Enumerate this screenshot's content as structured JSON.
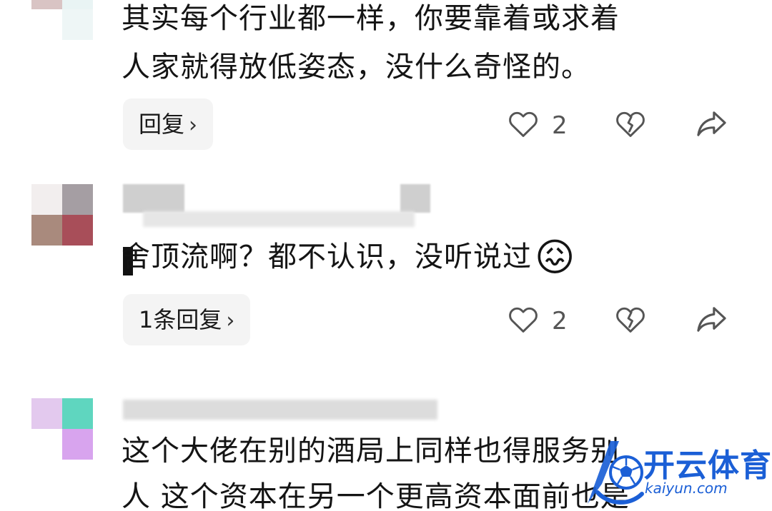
{
  "comments": [
    {
      "lines": [
        "其实每个行业都一样，你要靠着或求着",
        "人家就得放低姿态，没什么奇怪的。"
      ],
      "reply_label": "回复",
      "like_count": "2"
    },
    {
      "lines": [
        "舍顶流啊？都不认识，没听说过"
      ],
      "emoji": "😖",
      "reply_label": "1条回复",
      "like_count": "2"
    },
    {
      "lines": [
        "这个大佬在别的酒局上同样也得服务别",
        "人 这个资本在另一个更高资本面前也是"
      ]
    }
  ],
  "icons": {
    "like": "heart-outline-icon",
    "dislike": "broken-heart-icon",
    "share": "share-arrow-icon",
    "chevron": "chevron-right-icon"
  },
  "watermark": {
    "title": "开云体育",
    "url": "kaiyun.com"
  },
  "colors": {
    "text": "#141414",
    "count": "#555555",
    "button_bg": "#f4f4f4",
    "icon": "#555555",
    "watermark": "#1b5fd6"
  }
}
